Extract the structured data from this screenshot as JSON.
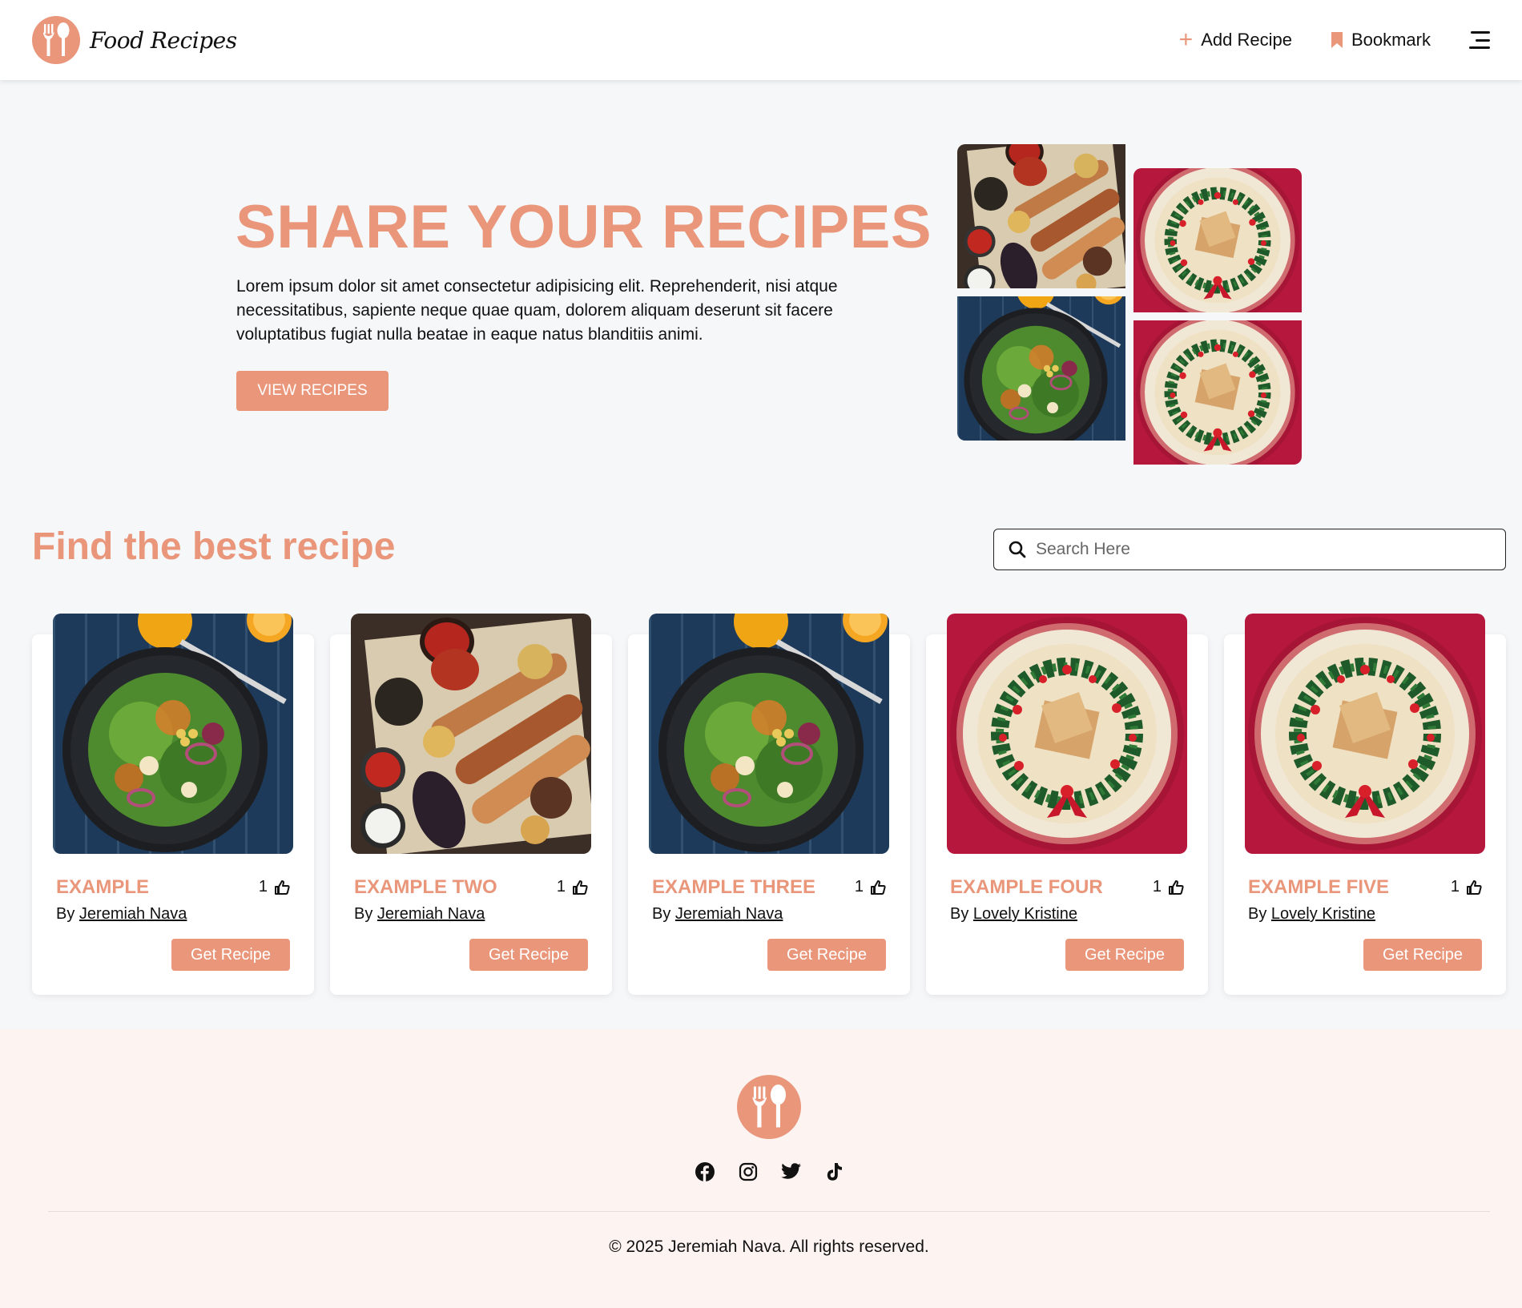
{
  "nav": {
    "brand": "Food Recipes",
    "add_recipe": "Add Recipe",
    "bookmark": "Bookmark",
    "logo_icon": "fork-spoon-icon",
    "menu_icon": "hamburger-menu-icon"
  },
  "hero": {
    "title": "SHARE YOUR RECIPES",
    "text": "Lorem ipsum dolor sit amet consectetur adipisicing elit. Reprehenderit, nisi atque necessitatibus, sapiente neque quae quam, dolorem aliquam deserunt sit facere voluptatibus fugiat nulla beatae in eaque natus blanditiis animi.",
    "button": "VIEW RECIPES"
  },
  "find": {
    "title": "Find the best recipe",
    "search_placeholder": "Search Here"
  },
  "cards": [
    {
      "title": "EXAMPLE",
      "likes": "1",
      "by": "By",
      "author": "Jeremiah Nava",
      "button": "Get Recipe",
      "image": "salad"
    },
    {
      "title": "EXAMPLE TWO",
      "likes": "1",
      "by": "By",
      "author": "Jeremiah Nava",
      "button": "Get Recipe",
      "image": "grill"
    },
    {
      "title": "EXAMPLE THREE",
      "likes": "1",
      "by": "By",
      "author": "Jeremiah Nava",
      "button": "Get Recipe",
      "image": "salad"
    },
    {
      "title": "EXAMPLE FOUR",
      "likes": "1",
      "by": "By",
      "author": "Lovely Kristine",
      "button": "Get Recipe",
      "image": "wreath"
    },
    {
      "title": "EXAMPLE FIVE",
      "likes": "1",
      "by": "By",
      "author": "Lovely Kristine",
      "button": "Get Recipe",
      "image": "wreath"
    }
  ],
  "footer": {
    "socials": [
      "facebook-icon",
      "instagram-icon",
      "twitter-icon",
      "tiktok-icon"
    ],
    "copyright": "© 2025 Jeremiah Nava. All rights reserved."
  },
  "colors": {
    "accent": "#e9967a",
    "page_bg": "#f6f7f9",
    "footer_bg": "#fdf3f1"
  }
}
